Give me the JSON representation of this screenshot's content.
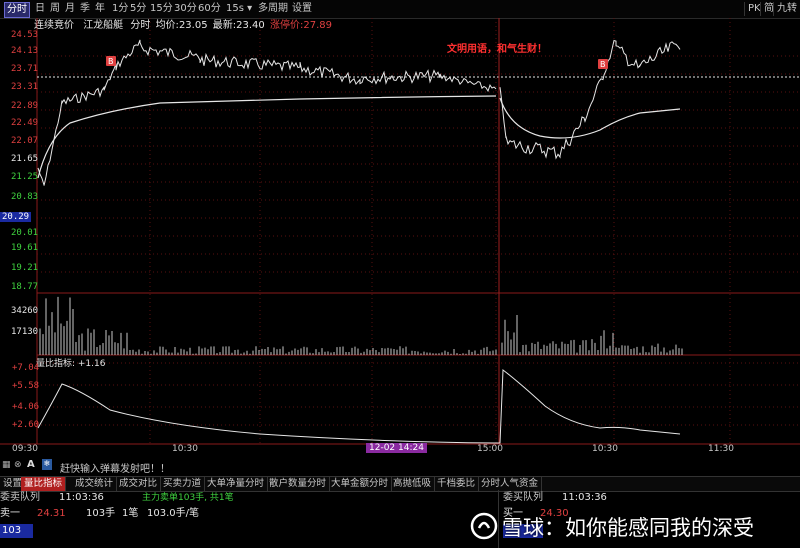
{
  "toolbar": {
    "items": [
      "分时",
      "日",
      "周",
      "月",
      "季",
      "年",
      "1分",
      "5分",
      "15分",
      "30分",
      "60分",
      "15s",
      "多周期",
      "设置"
    ],
    "active": "分时",
    "right_items": [
      "PK",
      "简",
      "九转"
    ]
  },
  "infobar": {
    "name": "连续竞价",
    "stock": "江龙船艇",
    "mode": "分时",
    "avg_label": "均价:",
    "avg_value": "23.05",
    "latest_label": "最新:",
    "latest_value": "23.40",
    "limit_label": "涨停价:",
    "limit_value": "27.89"
  },
  "annotation": "文明用语，和气生财！",
  "price_axis": [
    {
      "text": "24.53",
      "color": "red"
    },
    {
      "text": "24.13",
      "color": "red"
    },
    {
      "text": "23.71",
      "color": "red"
    },
    {
      "text": "23.31",
      "color": "red"
    },
    {
      "text": "22.89",
      "color": "red"
    },
    {
      "text": "22.49",
      "color": "red"
    },
    {
      "text": "22.07",
      "color": "red"
    },
    {
      "text": "21.65",
      "color": "white"
    },
    {
      "text": "21.25",
      "color": "green"
    },
    {
      "text": "20.83",
      "color": "green"
    },
    {
      "text": "20.29",
      "color": "blue"
    },
    {
      "text": "20.01",
      "color": "green"
    },
    {
      "text": "19.61",
      "color": "green"
    },
    {
      "text": "19.21",
      "color": "green"
    },
    {
      "text": "18.77",
      "color": "green"
    }
  ],
  "volume_axis": [
    "34260",
    "17130"
  ],
  "indicator": {
    "label": "量比指标: +1.16",
    "axis": [
      "+7.04",
      "+5.58",
      "+4.06",
      "+2.60"
    ]
  },
  "time_axis": {
    "start": "09:30",
    "labels": [
      "10:30",
      "15:00",
      "10:30",
      "11:30"
    ],
    "cursor": "12-02 14:24"
  },
  "danmu": {
    "placeholder": "赶快输入弹幕发射吧！！"
  },
  "bottom_tabs": [
    "设置",
    "量比指标",
    "成交统计",
    "成交对比",
    "买卖力道",
    "大单净量分时",
    "散户数量分时",
    "大单金额分时",
    "高抛低吸",
    "千档委比",
    "分时人气资金"
  ],
  "bottom_active": "量比指标",
  "sell_queue": {
    "title": "委卖队列",
    "time": "11:03:36",
    "info": "主力卖单103手, 共1笔",
    "row_label": "卖一",
    "price": "24.31",
    "qty": "103手",
    "count": "1笔",
    "detail": "103.0手/笔",
    "selected": "103"
  },
  "buy_queue": {
    "title": "委买队列",
    "time": "11:03:36",
    "row_label": "买一",
    "price": "24.30"
  },
  "watermark": "雪球：如你能感同我的深受",
  "colors": {
    "up": "#e04040",
    "down": "#3fd23f",
    "accent": "#b02020",
    "annotation": "#ff3030"
  }
}
